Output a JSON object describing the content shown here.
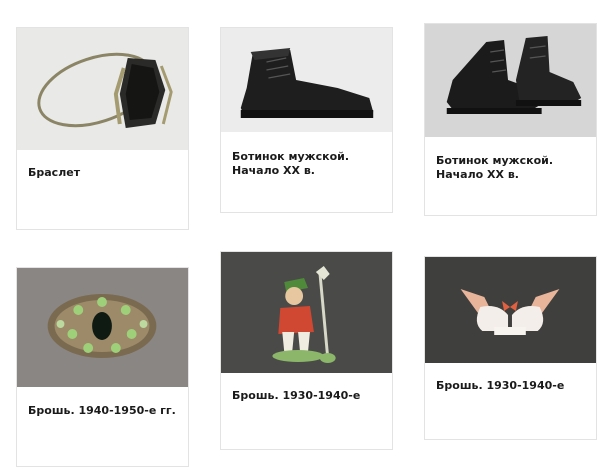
{
  "items": [
    {
      "title": "Браслет",
      "image": "bracelet-photo"
    },
    {
      "title": "Ботинок мужской.\nНачало XX в.",
      "image": "mens-boot-photo"
    },
    {
      "title": "Ботинок мужской.\nНачало XX в.",
      "image": "mens-boots-pair-photo"
    },
    {
      "title": "Брошь. 1940-1950-е гг.",
      "image": "brooch-jeweled-photo"
    },
    {
      "title": "Брошь. 1930-1940-е",
      "image": "brooch-boy-figure-photo"
    },
    {
      "title": "Брошь. 1930-1940-е",
      "image": "brooch-birds-photo"
    }
  ]
}
